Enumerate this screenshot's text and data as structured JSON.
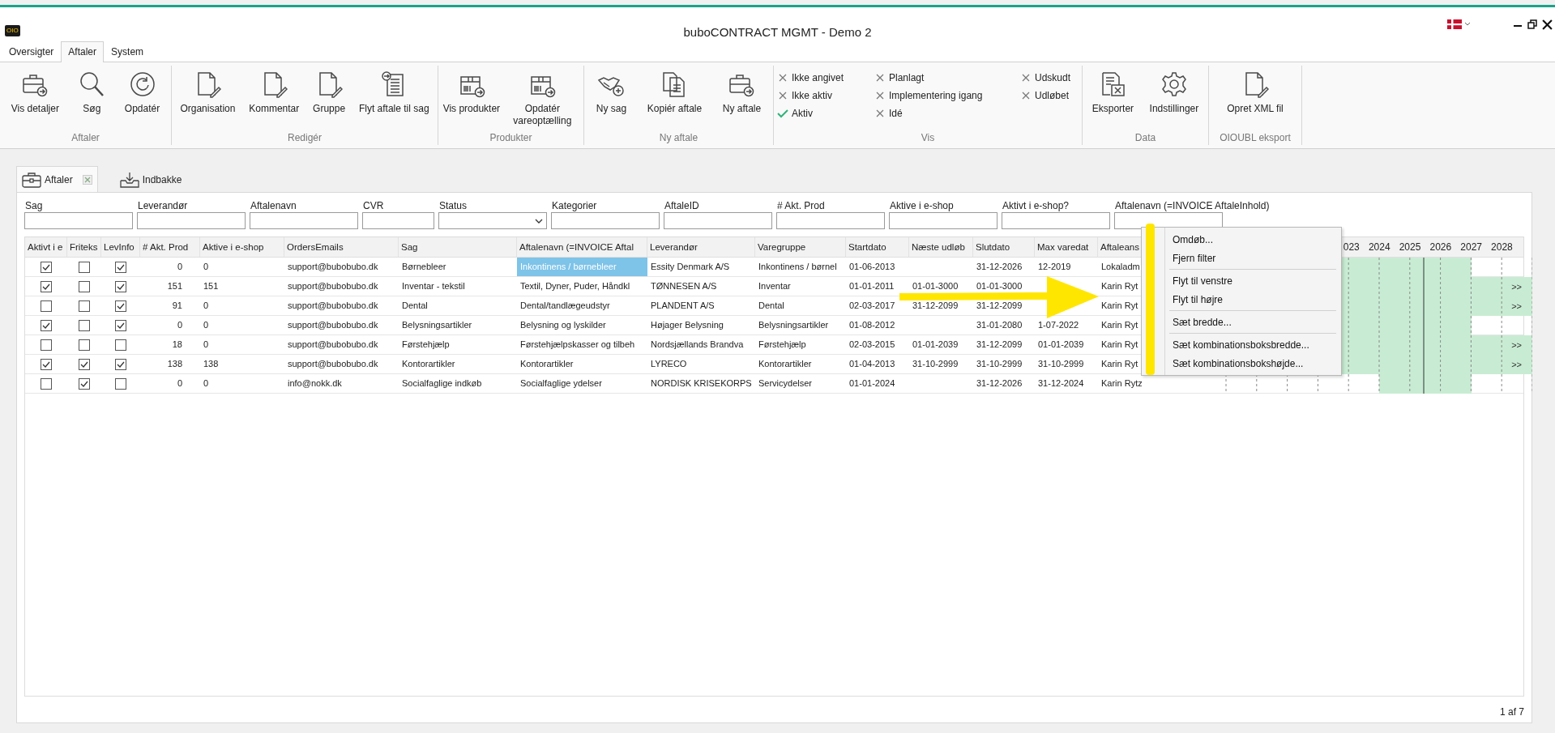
{
  "window": {
    "title": "buboCONTRACT MGMT - Demo 2",
    "logo": "OIO"
  },
  "tabs": [
    {
      "label": "Oversigter",
      "selected": false
    },
    {
      "label": "Aftaler",
      "selected": true
    },
    {
      "label": "System",
      "selected": false
    }
  ],
  "ribbon": {
    "groups": [
      {
        "label": "Aftaler",
        "kind": "buttons",
        "buttons": [
          "Vis detaljer",
          "Søg",
          "Opdatér"
        ]
      },
      {
        "label": "Redigér",
        "kind": "buttons",
        "buttons": [
          "Organisation",
          "Kommentar",
          "Gruppe",
          "Flyt aftale til sag"
        ]
      },
      {
        "label": "Produkter",
        "kind": "buttons",
        "buttons": [
          "Vis produkter",
          "Opdatér vareoptælling"
        ]
      },
      {
        "label": "Ny aftale",
        "kind": "buttons",
        "buttons": [
          "Ny sag",
          "Kopiér aftale",
          "Ny aftale"
        ]
      },
      {
        "label": "Vis",
        "kind": "filters",
        "items": [
          {
            "label": "Ikke angivet",
            "checked": false
          },
          {
            "label": "Ikke aktiv",
            "checked": false
          },
          {
            "label": "Aktiv",
            "checked": true
          },
          {
            "label": "Planlagt",
            "checked": false
          },
          {
            "label": "Implementering igang",
            "checked": false
          },
          {
            "label": "Idé",
            "checked": false
          },
          {
            "label": "Udskudt",
            "checked": false
          },
          {
            "label": "Udløbet",
            "checked": false
          }
        ]
      },
      {
        "label": "Data",
        "kind": "buttons",
        "buttons": [
          "Eksporter",
          "Indstillinger"
        ]
      },
      {
        "label": "OIOUBL eksport",
        "kind": "buttons",
        "buttons": [
          "Opret XML fil"
        ]
      }
    ]
  },
  "doc_tabs": [
    {
      "label": "Aftaler",
      "selected": true,
      "closable": true
    },
    {
      "label": "Indbakke",
      "selected": false,
      "closable": false
    }
  ],
  "filters": [
    {
      "label": "Sag",
      "kind": "text"
    },
    {
      "label": "Leverandør",
      "kind": "text"
    },
    {
      "label": "Aftalenavn",
      "kind": "text"
    },
    {
      "label": "CVR",
      "kind": "narrow"
    },
    {
      "label": "Status",
      "kind": "combo"
    },
    {
      "label": "Kategorier",
      "kind": "text"
    },
    {
      "label": "AftaleID",
      "kind": "text"
    },
    {
      "label": "# Akt. Prod",
      "kind": "text"
    },
    {
      "label": "Aktive i e-shop",
      "kind": "text"
    },
    {
      "label": "Aktivt i e-shop?",
      "kind": "text"
    },
    {
      "label": "Aftalenavn (=INVOICE AftaleInhold)",
      "kind": "text"
    }
  ],
  "table": {
    "columns": [
      "Aktivt i e",
      "Friteks",
      "LevInfo",
      "# Akt. Prod",
      "Aktive i e-shop",
      "OrdersEmails",
      "Sag",
      "Aftalenavn (=INVOICE Aftal",
      "Leverandør",
      "Varegruppe",
      "Startdato",
      "Næste udløb",
      "Slutdato",
      "Max varedat",
      "Aftaleans"
    ],
    "years": [
      "023",
      "2024",
      "2025",
      "2026",
      "2027",
      "2028"
    ],
    "rows": [
      {
        "cells": [
          {
            "kind": "check",
            "checked": true
          },
          {
            "kind": "check",
            "checked": false
          },
          {
            "kind": "check",
            "checked": true
          },
          {
            "kind": "text",
            "text": "0"
          },
          {
            "kind": "text",
            "text": "0"
          },
          {
            "kind": "text",
            "text": "support@bubobubo.dk"
          },
          {
            "kind": "text",
            "text": "Børnebleer"
          },
          {
            "kind": "text",
            "text": "Inkontinens / børnebleer",
            "selected": true
          },
          {
            "kind": "text",
            "text": "Essity Denmark A/S"
          },
          {
            "kind": "text",
            "text": "Inkontinens / børnel"
          },
          {
            "kind": "text",
            "text": "01-06-2013"
          },
          {
            "kind": "empty"
          },
          {
            "kind": "text",
            "text": "31-12-2026"
          },
          {
            "kind": "text",
            "text": "12-2019"
          },
          {
            "kind": "text",
            "text": "Lokaladm"
          }
        ],
        "kind": "to_2026"
      },
      {
        "cells": [
          {
            "kind": "check",
            "checked": true
          },
          {
            "kind": "check",
            "checked": false
          },
          {
            "kind": "check",
            "checked": true
          },
          {
            "kind": "text",
            "text": "151"
          },
          {
            "kind": "text",
            "text": "151"
          },
          {
            "kind": "text",
            "text": "support@bubobubo.dk"
          },
          {
            "kind": "text",
            "text": "Inventar - tekstil"
          },
          {
            "kind": "text",
            "text": "Textil, Dyner, Puder, Håndkl",
            "selected": false
          },
          {
            "kind": "text",
            "text": "TØNNESEN A/S"
          },
          {
            "kind": "text",
            "text": "Inventar"
          },
          {
            "kind": "text",
            "text": "01-01-2011"
          },
          {
            "kind": "text",
            "text": "01-01-3000"
          },
          {
            "kind": "text",
            "text": "01-01-3000"
          },
          {
            "kind": "empty"
          },
          {
            "kind": "text",
            "text": "Karin Ryt"
          }
        ],
        "kind": "to_edge",
        "more": ">>"
      },
      {
        "cells": [
          {
            "kind": "check",
            "checked": false
          },
          {
            "kind": "check",
            "checked": false
          },
          {
            "kind": "check",
            "checked": true
          },
          {
            "kind": "text",
            "text": "91"
          },
          {
            "kind": "text",
            "text": "0"
          },
          {
            "kind": "text",
            "text": "support@bubobubo.dk"
          },
          {
            "kind": "text",
            "text": "Dental"
          },
          {
            "kind": "text",
            "text": "Dental/tandlægeudstyr",
            "selected": false
          },
          {
            "kind": "text",
            "text": "PLANDENT A/S"
          },
          {
            "kind": "text",
            "text": "Dental"
          },
          {
            "kind": "text",
            "text": "02-03-2017"
          },
          {
            "kind": "text",
            "text": "31-12-2099"
          },
          {
            "kind": "text",
            "text": "31-12-2099"
          },
          {
            "kind": "empty"
          },
          {
            "kind": "text",
            "text": "Karin Ryt"
          }
        ],
        "kind": "to_edge",
        "more": ">>"
      },
      {
        "cells": [
          {
            "kind": "check",
            "checked": true
          },
          {
            "kind": "check",
            "checked": false
          },
          {
            "kind": "check",
            "checked": true
          },
          {
            "kind": "text",
            "text": "0"
          },
          {
            "kind": "text",
            "text": "0"
          },
          {
            "kind": "text",
            "text": "support@bubobubo.dk"
          },
          {
            "kind": "text",
            "text": "Belysningsartikler"
          },
          {
            "kind": "text",
            "text": "Belysning og lyskilder",
            "selected": false
          },
          {
            "kind": "text",
            "text": "Højager Belysning"
          },
          {
            "kind": "text",
            "text": "Belysningsartikler"
          },
          {
            "kind": "text",
            "text": "01-08-2012"
          },
          {
            "kind": "empty"
          },
          {
            "kind": "text",
            "text": "31-01-2080"
          },
          {
            "kind": "text",
            "text": "1-07-2022"
          },
          {
            "kind": "text",
            "text": "Karin Ryt"
          }
        ],
        "kind": "to_2026"
      },
      {
        "cells": [
          {
            "kind": "check",
            "checked": false
          },
          {
            "kind": "check",
            "checked": false
          },
          {
            "kind": "check",
            "checked": false
          },
          {
            "kind": "text",
            "text": "18"
          },
          {
            "kind": "text",
            "text": "0"
          },
          {
            "kind": "text",
            "text": "support@bubobubo.dk"
          },
          {
            "kind": "text",
            "text": "Førstehjælp"
          },
          {
            "kind": "text",
            "text": "Førstehjælpskasser og tilbeh",
            "selected": false
          },
          {
            "kind": "text",
            "text": "Nordsjællands Brandva"
          },
          {
            "kind": "text",
            "text": "Førstehjælp"
          },
          {
            "kind": "text",
            "text": "02-03-2015"
          },
          {
            "kind": "text",
            "text": "01-01-2039"
          },
          {
            "kind": "text",
            "text": "31-12-2099"
          },
          {
            "kind": "text",
            "text": "01-01-2039"
          },
          {
            "kind": "text",
            "text": "Karin Ryt"
          }
        ],
        "kind": "to_edge",
        "more": ">>"
      },
      {
        "cells": [
          {
            "kind": "check",
            "checked": true
          },
          {
            "kind": "check",
            "checked": true
          },
          {
            "kind": "check",
            "checked": true
          },
          {
            "kind": "text",
            "text": "138"
          },
          {
            "kind": "text",
            "text": "138"
          },
          {
            "kind": "text",
            "text": "support@bubobubo.dk"
          },
          {
            "kind": "text",
            "text": "Kontorartikler"
          },
          {
            "kind": "text",
            "text": "Kontorartikler",
            "selected": false
          },
          {
            "kind": "text",
            "text": "LYRECO"
          },
          {
            "kind": "text",
            "text": "Kontorartikler"
          },
          {
            "kind": "text",
            "text": "01-04-2013"
          },
          {
            "kind": "text",
            "text": "31-10-2999"
          },
          {
            "kind": "text",
            "text": "31-10-2999"
          },
          {
            "kind": "text",
            "text": "31-10-2999"
          },
          {
            "kind": "text",
            "text": "Karin Ryt"
          }
        ],
        "kind": "to_edge",
        "more": ">>"
      },
      {
        "cells": [
          {
            "kind": "check",
            "checked": false
          },
          {
            "kind": "check",
            "checked": true
          },
          {
            "kind": "check",
            "checked": false
          },
          {
            "kind": "text",
            "text": "0"
          },
          {
            "kind": "text",
            "text": "0"
          },
          {
            "kind": "text",
            "text": "info@nokk.dk"
          },
          {
            "kind": "text",
            "text": "Socialfaglige indkøb"
          },
          {
            "kind": "text",
            "text": "Socialfaglige ydelser",
            "selected": false
          },
          {
            "kind": "text",
            "text": "NORDISK KRISEKORPS"
          },
          {
            "kind": "text",
            "text": "Servicydelser"
          },
          {
            "kind": "text",
            "text": "01-01-2024"
          },
          {
            "kind": "empty"
          },
          {
            "kind": "text",
            "text": "31-12-2026"
          },
          {
            "kind": "text",
            "text": "31-12-2024"
          },
          {
            "kind": "text",
            "text": "Karin Rytz"
          }
        ],
        "kind": "short"
      }
    ]
  },
  "context_menu": [
    {
      "label": "Omdøb...",
      "separator_before": false
    },
    {
      "label": "Fjern filter",
      "separator_before": false
    },
    {
      "label": "Flyt til venstre",
      "separator_before": true
    },
    {
      "label": "Flyt til højre",
      "separator_before": false
    },
    {
      "label": "Sæt bredde...",
      "separator_before": true
    },
    {
      "label": "Sæt kombinationsboksbredde...",
      "separator_before": true
    },
    {
      "label": "Sæt kombinationsbokshøjde...",
      "separator_before": false
    }
  ],
  "pager": "1 af 7"
}
